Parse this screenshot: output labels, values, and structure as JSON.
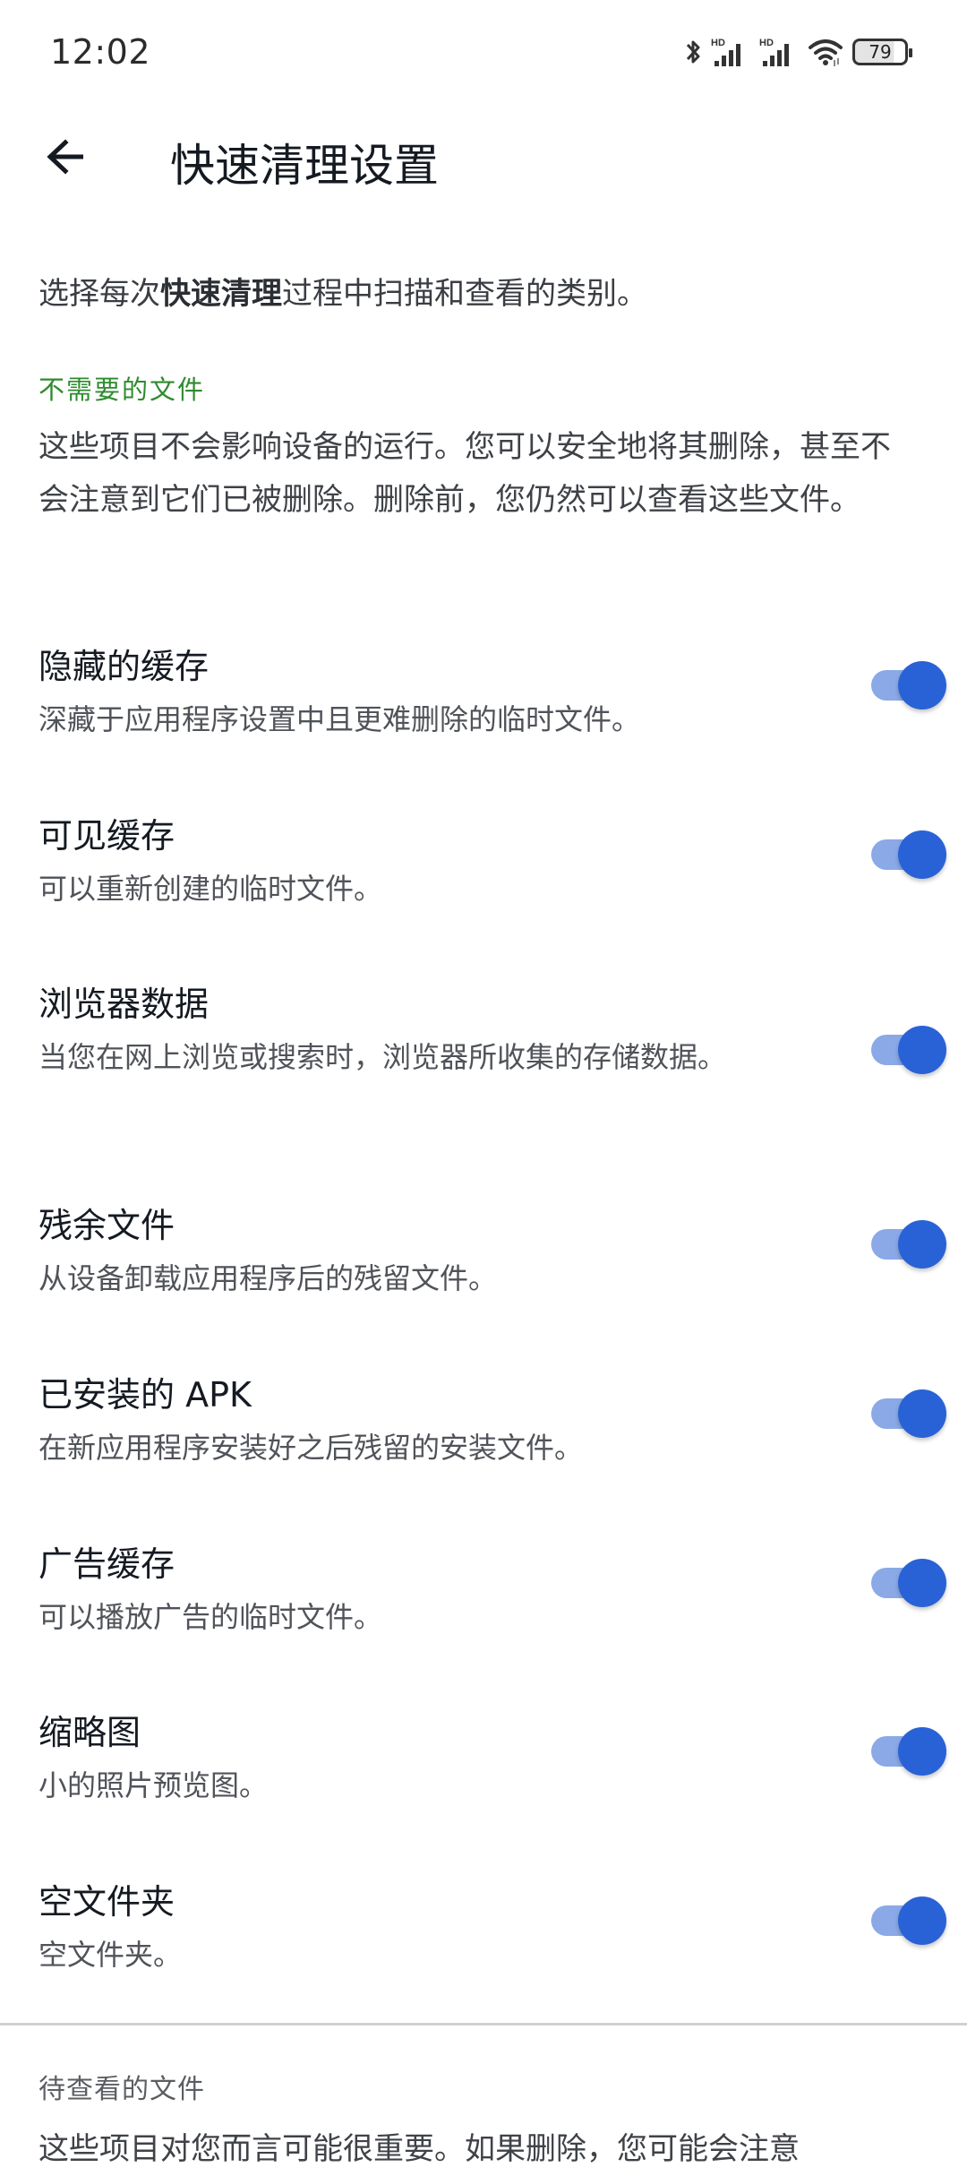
{
  "status_bar": {
    "time": "12:02",
    "icons": [
      "bluetooth-icon",
      "signal-hd-icon",
      "signal-hd-icon",
      "wifi-icon",
      "battery-icon"
    ],
    "signal_label": "HD",
    "battery_level": "79"
  },
  "header": {
    "back_icon": "arrow-left-icon",
    "title": "快速清理设置"
  },
  "intro": {
    "prefix": "选择每次",
    "bold": "快速清理",
    "suffix": "过程中扫描和查看的类别。"
  },
  "unneeded_section": {
    "header": "不需要的文件",
    "header_color": "#2e8b2e",
    "description": "这些项目不会影响设备的运行。您可以安全地将其删除，甚至不会注意到它们已被删除。删除前，您仍然可以查看这些文件。",
    "items": [
      {
        "title": "隐藏的缓存",
        "subtitle": "深藏于应用程序设置中且更难删除的临时文件。",
        "enabled": true
      },
      {
        "title": "可见缓存",
        "subtitle": "可以重新创建的临时文件。",
        "enabled": true
      },
      {
        "title": "浏览器数据",
        "subtitle": "当您在网上浏览或搜索时，浏览器所收集的存储数据。",
        "enabled": true
      },
      {
        "title": "残余文件",
        "subtitle": "从设备卸载应用程序后的残留文件。",
        "enabled": true
      },
      {
        "title": "已安装的 APK",
        "subtitle": "在新应用程序安装好之后残留的安装文件。",
        "enabled": true
      },
      {
        "title": "广告缓存",
        "subtitle": "可以播放广告的临时文件。",
        "enabled": true
      },
      {
        "title": "缩略图",
        "subtitle": "小的照片预览图。",
        "enabled": true
      },
      {
        "title": "空文件夹",
        "subtitle": "空文件夹。",
        "enabled": true
      }
    ]
  },
  "review_section": {
    "header": "待查看的文件",
    "description": "这些项目对您而言可能很重要。如果删除，您可能会注意"
  },
  "colors": {
    "toggle_thumb": "#2962d6",
    "toggle_track": "#8aa9e6",
    "divider": "#d0d0d0"
  }
}
